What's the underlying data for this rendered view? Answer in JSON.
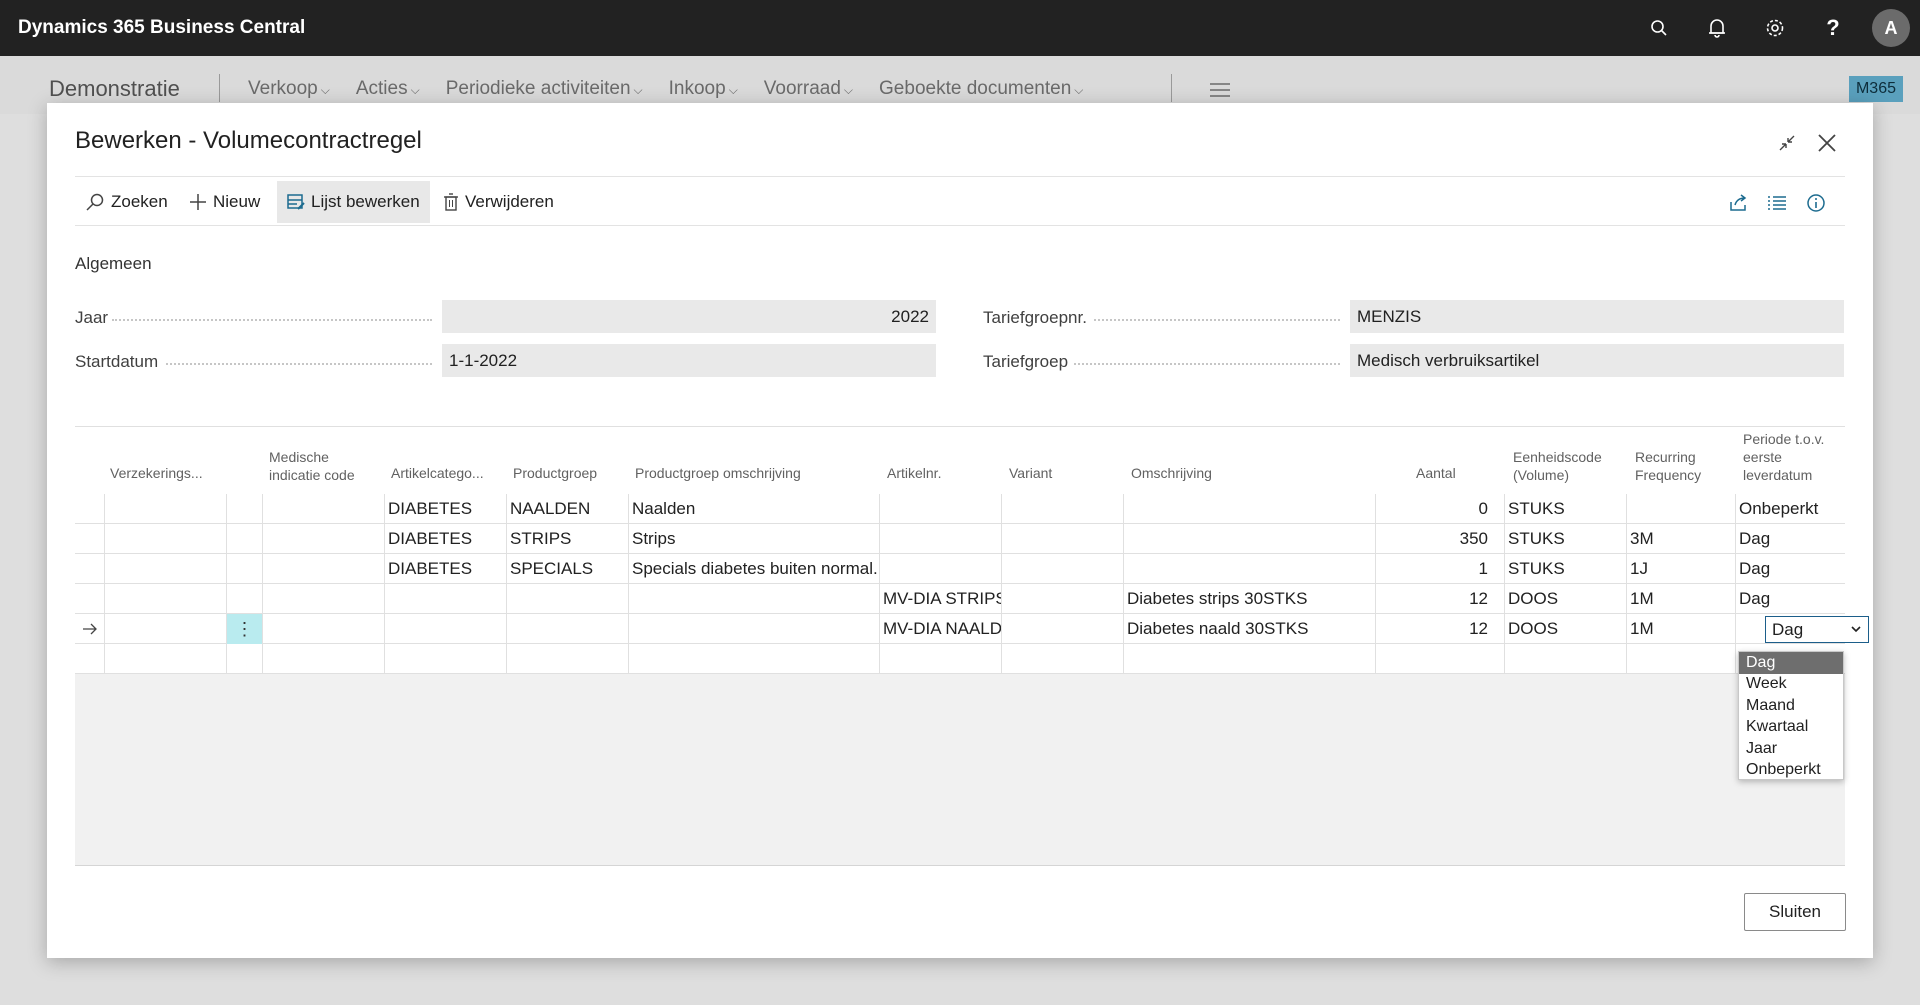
{
  "app": {
    "title": "Dynamics 365 Business Central",
    "avatar_letter": "A"
  },
  "nav": {
    "company": "Demonstratie",
    "items": [
      "Verkoop",
      "Acties",
      "Periodieke activiteiten",
      "Inkoop",
      "Voorraad",
      "Geboekte documenten"
    ],
    "badge": "M365"
  },
  "dialog": {
    "title": "Bewerken - Volumecontractregel",
    "actions": {
      "search": "Zoeken",
      "new": "Nieuw",
      "edit_list": "Lijst bewerken",
      "delete": "Verwijderen"
    },
    "section": "Algemeen",
    "fields": {
      "jaar_label": "Jaar",
      "jaar_value": "2022",
      "startdatum_label": "Startdatum",
      "startdatum_value": "1-1-2022",
      "tariefgroepnr_label": "Tariefgroepnr.",
      "tariefgroepnr_value": "MENZIS",
      "tariefgroep_label": "Tariefgroep",
      "tariefgroep_value": "Medisch verbruiksartikel"
    },
    "columns": {
      "verzekering": "Verzekerings...",
      "medische_1": "Medische",
      "medische_2": "indicatie code",
      "artikelcategorie": "Artikelcatego...",
      "productgroep": "Productgroep",
      "productgroep_omschrijving": "Productgroep omschrijving",
      "artikelnr": "Artikelnr.",
      "variant": "Variant",
      "omschrijving": "Omschrijving",
      "aantal": "Aantal",
      "eenheid_1": "Eenheidscode",
      "eenheid_2": "(Volume)",
      "recurring_1": "Recurring",
      "recurring_2": "Frequency",
      "periode_1": "Periode t.o.v.",
      "periode_2": "eerste",
      "periode_3": "leverdatum"
    },
    "rows": [
      {
        "categorie": "DIABETES",
        "productgroep": "NAALDEN",
        "omschr_groep": "Naalden",
        "artikelnr": "",
        "omschrijving": "",
        "aantal": "0",
        "eenheid": "STUKS",
        "frequency": "",
        "periode": "Onbeperkt"
      },
      {
        "categorie": "DIABETES",
        "productgroep": "STRIPS",
        "omschr_groep": "Strips",
        "artikelnr": "",
        "omschrijving": "",
        "aantal": "350",
        "eenheid": "STUKS",
        "frequency": "3M",
        "periode": "Dag"
      },
      {
        "categorie": "DIABETES",
        "productgroep": "SPECIALS",
        "omschr_groep": "Specials diabetes buiten normal...",
        "artikelnr": "",
        "omschrijving": "",
        "aantal": "1",
        "eenheid": "STUKS",
        "frequency": "1J",
        "periode": "Dag"
      },
      {
        "categorie": "",
        "productgroep": "",
        "omschr_groep": "",
        "artikelnr": "MV-DIA STRIPS",
        "omschrijving": "Diabetes strips  30STKS",
        "aantal": "12",
        "eenheid": "DOOS",
        "frequency": "1M",
        "periode": "Dag"
      },
      {
        "categorie": "",
        "productgroep": "",
        "omschr_groep": "",
        "artikelnr": "MV-DIA NAALD",
        "omschrijving": "Diabetes naald  30STKS",
        "aantal": "12",
        "eenheid": "DOOS",
        "frequency": "1M",
        "periode": "Dag"
      }
    ],
    "periode_options": [
      "Dag",
      "Week",
      "Maand",
      "Kwartaal",
      "Jaar",
      "Onbeperkt"
    ],
    "selected_option": "Dag",
    "close_label": "Sluiten"
  },
  "colors": {
    "topbar": "#222222",
    "accent_cell": "#b9ebef",
    "badge": "#5aa0bd"
  }
}
